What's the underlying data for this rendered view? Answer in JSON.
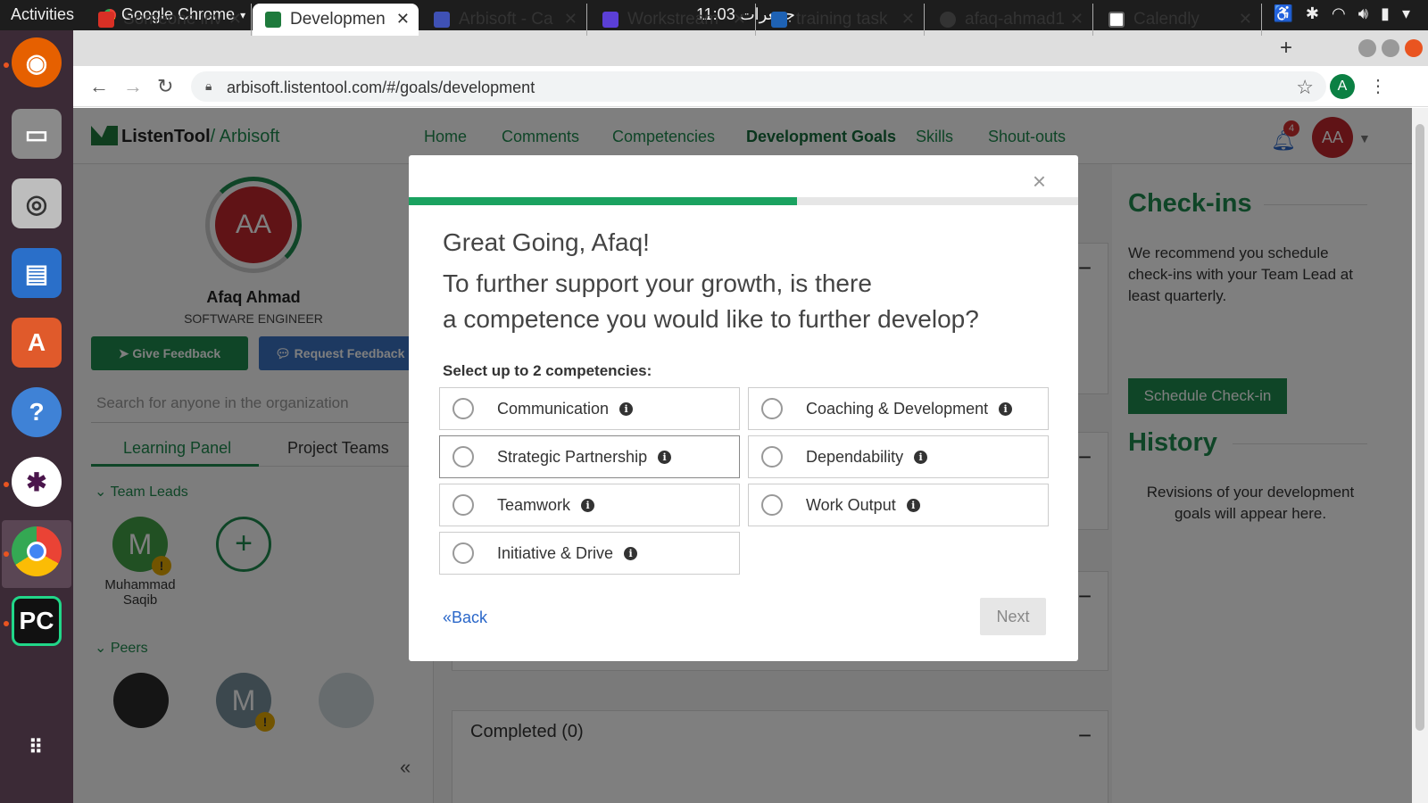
{
  "system": {
    "activities": "Activities",
    "app_name": "Google Chrome",
    "clock": "جمعرات 11:03"
  },
  "browser": {
    "tabs": [
      {
        "title": "Someone inv",
        "favicon_color": "#d93025",
        "favicon": "gmail-icon"
      },
      {
        "title": "Developmen",
        "favicon_color": "#1e7a3c",
        "favicon": "listentool-icon"
      },
      {
        "title": "Arbisoft - Ca",
        "favicon_color": "#3f51b5",
        "favicon": "calendar-icon"
      },
      {
        "title": "Workstream",
        "favicon_color": "#5b3fd6",
        "favicon": "workstream-icon"
      },
      {
        "title": "training task",
        "favicon_color": "#1e62b4",
        "favicon": "trello-icon"
      },
      {
        "title": "afaq-ahmad1",
        "favicon_color": "#333333",
        "favicon": "github-icon"
      },
      {
        "title": "Calendly",
        "favicon_color": "#ffffff",
        "favicon": "calendly-icon"
      }
    ],
    "url": "arbisoft.listentool.com/#/goals/development",
    "profile_initial": "A"
  },
  "app": {
    "logo": "ListenTool",
    "org": "/ Arbisoft",
    "nav": [
      "Home",
      "Comments",
      "Competencies",
      "Development Goals",
      "Skills",
      "Shout-outs"
    ],
    "active_nav": "Development Goals",
    "notification_count": "4",
    "user_initials": "AA"
  },
  "profile": {
    "initials": "AA",
    "name": "Afaq Ahmad",
    "role": "SOFTWARE ENGINEER",
    "give_feedback": "Give Feedback",
    "request_feedback": "Request Feedback",
    "search_placeholder": "Search for anyone in the organization",
    "tabs": [
      "Learning Panel",
      "Project Teams"
    ],
    "team_leads_label": "Team Leads",
    "team_lead": {
      "initial": "M",
      "name_line1": "Muhammad",
      "name_line2": "Saqib"
    },
    "peers_label": "Peers",
    "peer_initial": "M"
  },
  "center": {
    "completed": "Completed (0)"
  },
  "sidebar_right": {
    "checkins_title": "Check-ins",
    "checkins_text": "We recommend you schedule check-ins with your Team Lead at least quarterly.",
    "schedule_button": "Schedule Check-in",
    "history_title": "History",
    "history_text": "Revisions of your development goals will appear here."
  },
  "modal": {
    "progress": 0.58,
    "greeting": "Great Going, Afaq!",
    "question_line1": "To further support your growth, is there",
    "question_line2": "a competence you would like to further develop?",
    "select_label": "Select up to 2 competencies:",
    "options": [
      "Communication",
      "Coaching & Development",
      "Strategic Partnership",
      "Dependability",
      "Teamwork",
      "Work Output",
      "Initiative & Drive"
    ],
    "back": "«Back",
    "next": "Next"
  },
  "colors": {
    "brand_green": "#1e8b4f",
    "progress_green": "#1aa260",
    "link_blue": "#2a67c9",
    "avatar_red": "#c0262c"
  }
}
